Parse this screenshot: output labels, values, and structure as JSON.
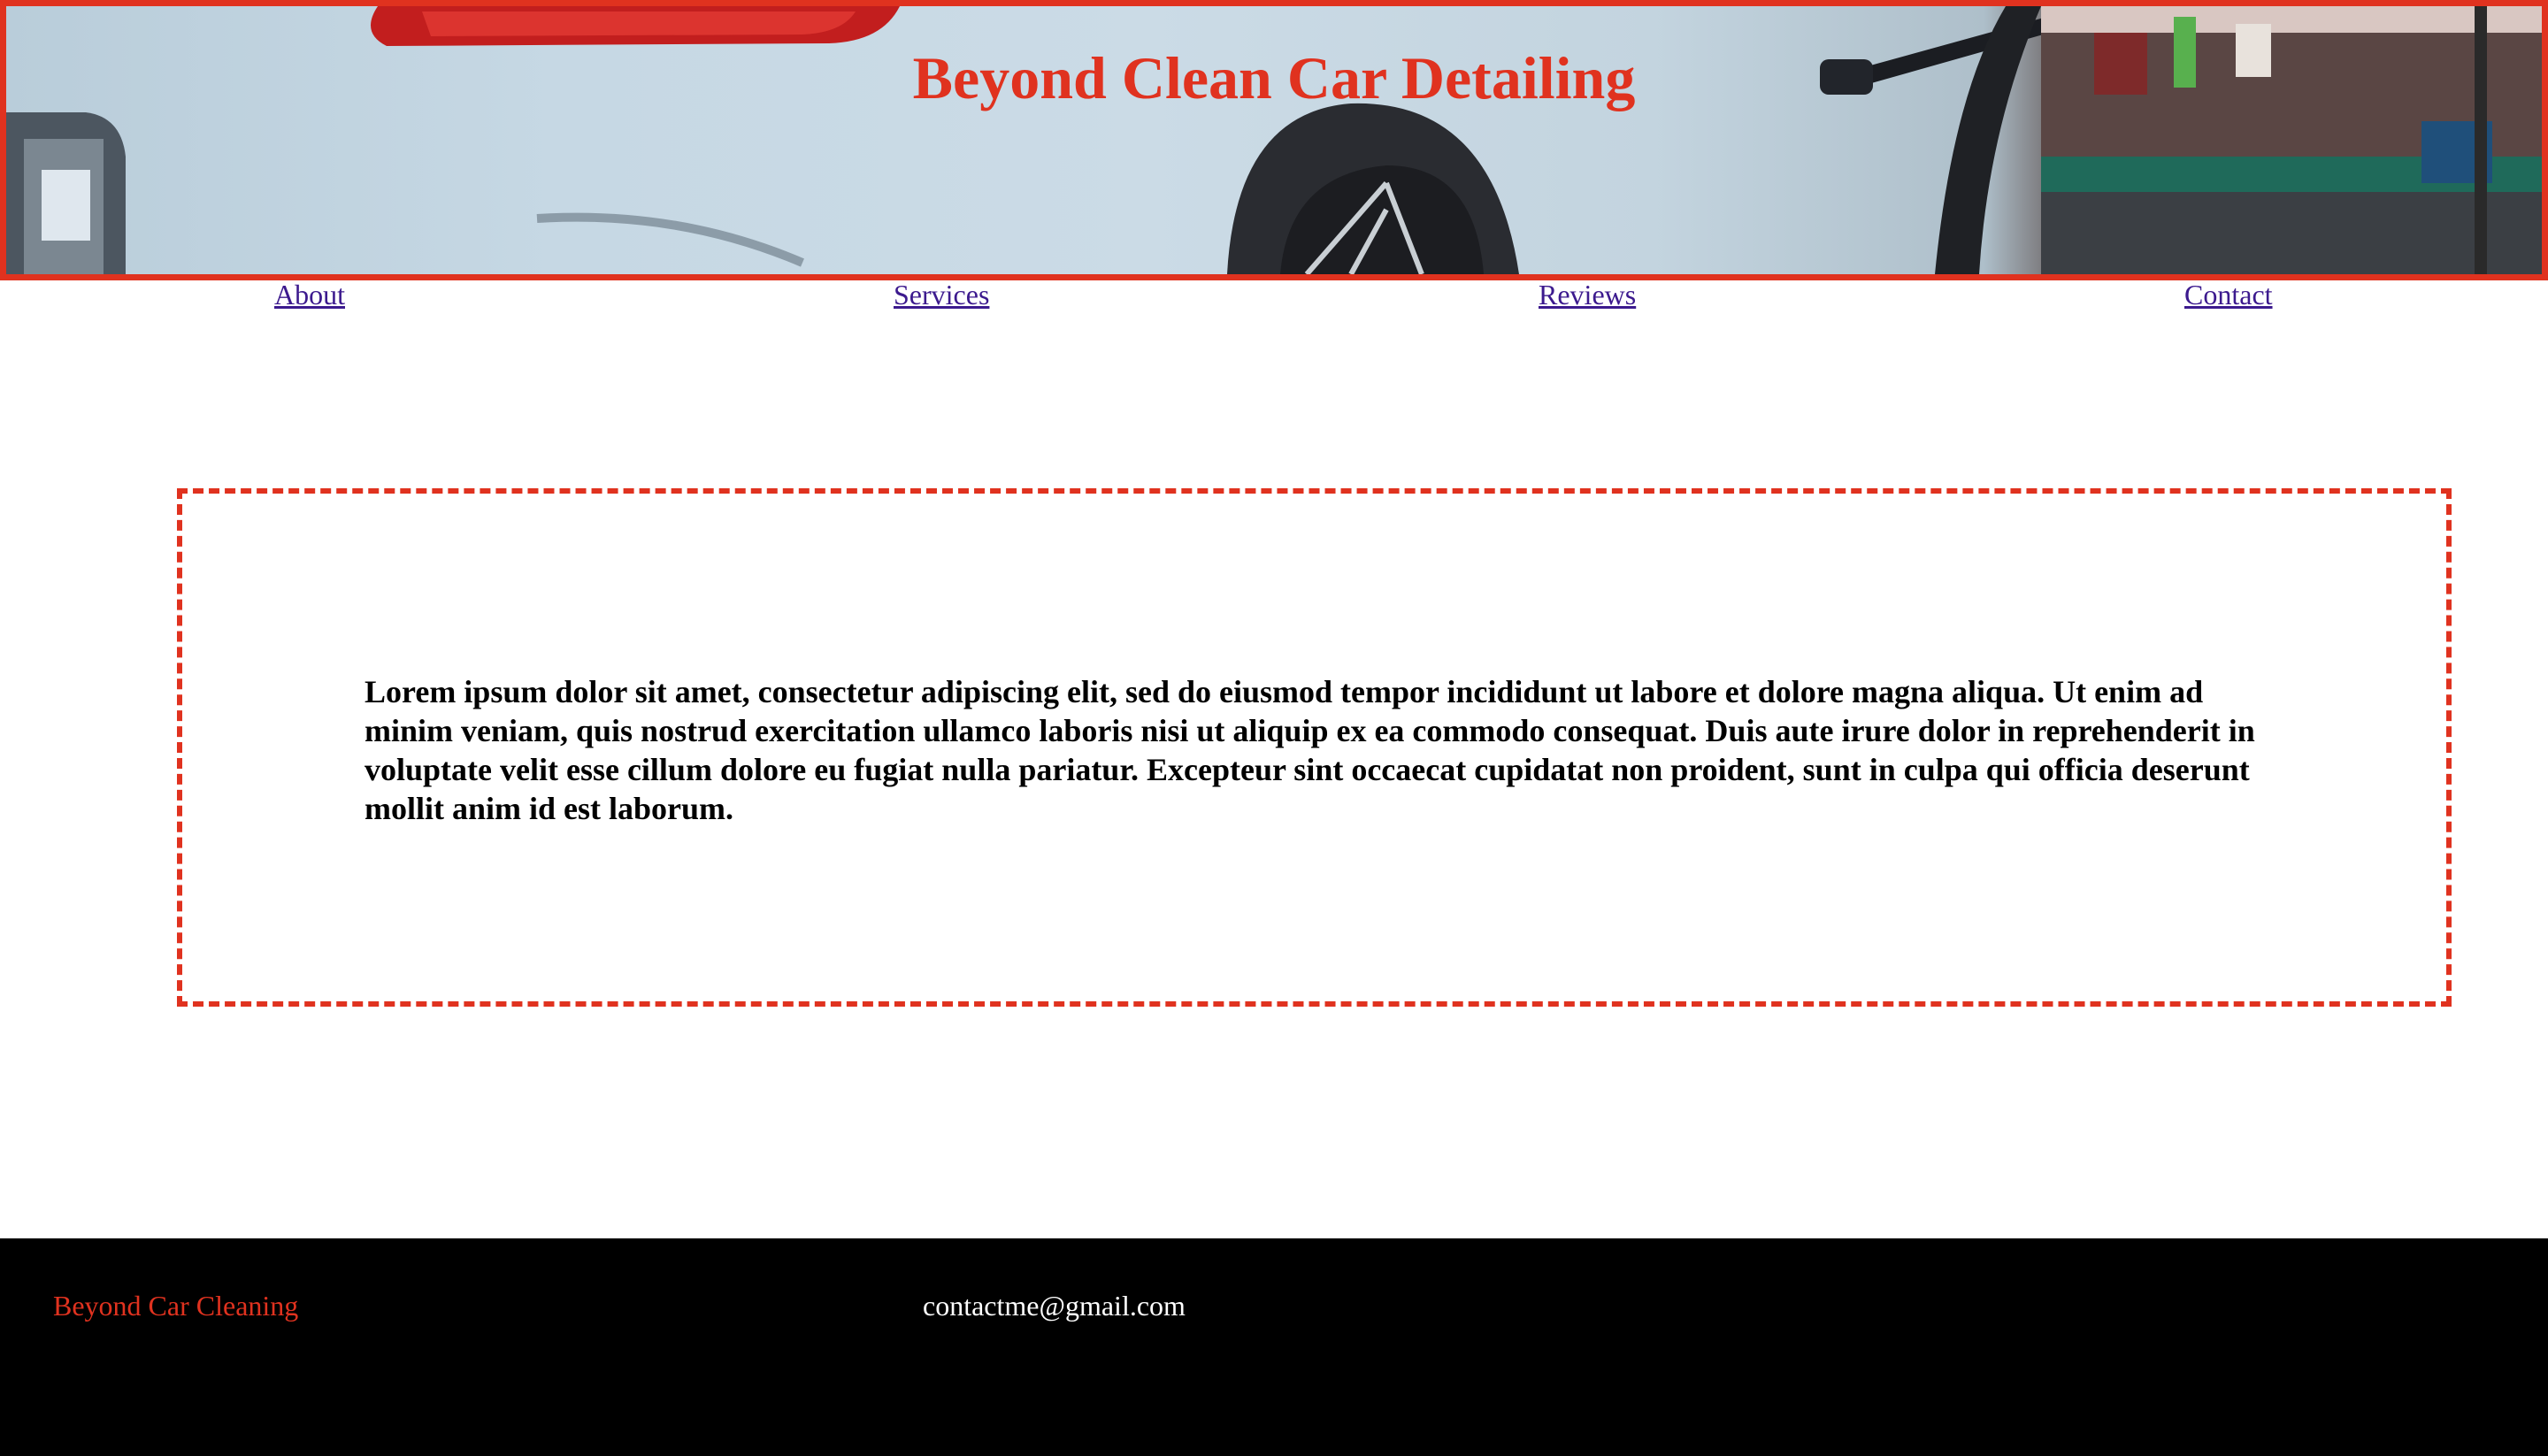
{
  "header": {
    "title": "Beyond Clean Car Detailing",
    "accent_color": "#e0321f"
  },
  "nav": {
    "items": [
      {
        "label": "About"
      },
      {
        "label": "Services"
      },
      {
        "label": "Reviews"
      },
      {
        "label": "Contact"
      }
    ],
    "link_color": "#3c1a8e"
  },
  "main": {
    "text": "Lorem ipsum dolor sit amet, consectetur adipiscing elit, sed do eiusmod tempor incididunt ut labore et dolore magna aliqua. Ut enim ad minim veniam, quis nostrud exercitation ullamco laboris nisi ut aliquip ex ea commodo consequat. Duis aute irure dolor in reprehenderit in voluptate velit esse cillum dolore eu fugiat nulla pariatur. Excepteur sint occaecat cupidatat non proident, sunt in culpa qui officia deserunt mollit anim id est laborum."
  },
  "footer": {
    "brand": "Beyond Car Cleaning",
    "email": "contactme@gmail.com",
    "background": "#000000"
  }
}
